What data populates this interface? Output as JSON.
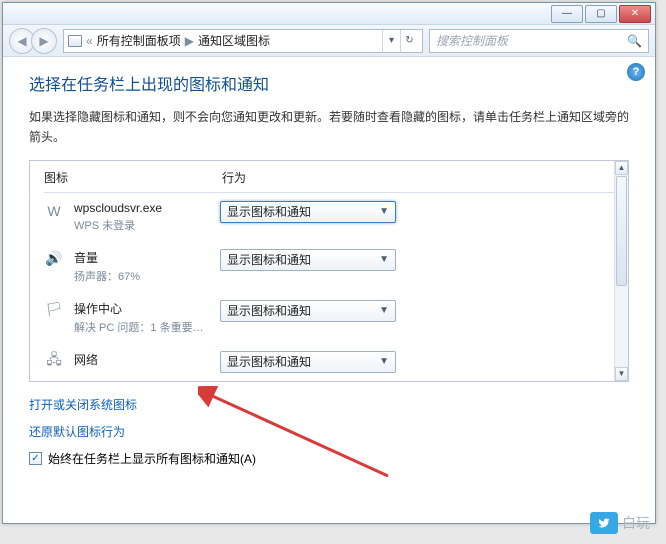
{
  "titlebar": {
    "min": "—",
    "max": "▢",
    "close": "✕"
  },
  "nav": {
    "back": "◀",
    "fwd": "▶",
    "bc_prefix": "«",
    "bc1": "所有控制面板项",
    "bc2": "通知区域图标",
    "sep": "▶",
    "drop": "▾",
    "refresh": "↻"
  },
  "search": {
    "placeholder": "搜索控制面板",
    "icon": "🔍"
  },
  "help": "?",
  "heading": "选择在任务栏上出现的图标和通知",
  "description": "如果选择隐藏图标和通知，则不会向您通知更改和更新。若要随时查看隐藏的图标，请单击任务栏上通知区域旁的箭头。",
  "cols": {
    "icon": "图标",
    "behavior": "行为"
  },
  "dd_options": {
    "show": "显示图标和通知"
  },
  "items": [
    {
      "icon": "W",
      "title": "wpscloudsvr.exe",
      "sub": "WPS 未登录",
      "val": "显示图标和通知",
      "active": true
    },
    {
      "icon": "🔊",
      "title": "音量",
      "sub": "扬声器：67%",
      "val": "显示图标和通知",
      "active": false
    },
    {
      "icon": "🏳",
      "title": "操作中心",
      "sub": "解决 PC 问题：1 条重要…",
      "val": "显示图标和通知",
      "active": false
    },
    {
      "icon": "🖧",
      "title": "网络",
      "sub": "",
      "val": "显示图标和通知",
      "active": false
    }
  ],
  "link_sysicons": "打开或关闭系统图标",
  "link_restore": "还原默认图标行为",
  "checkbox_label": "始终在任务栏上显示所有图标和通知(A)",
  "checkbox_checked": "✓",
  "watermark": "白玩"
}
